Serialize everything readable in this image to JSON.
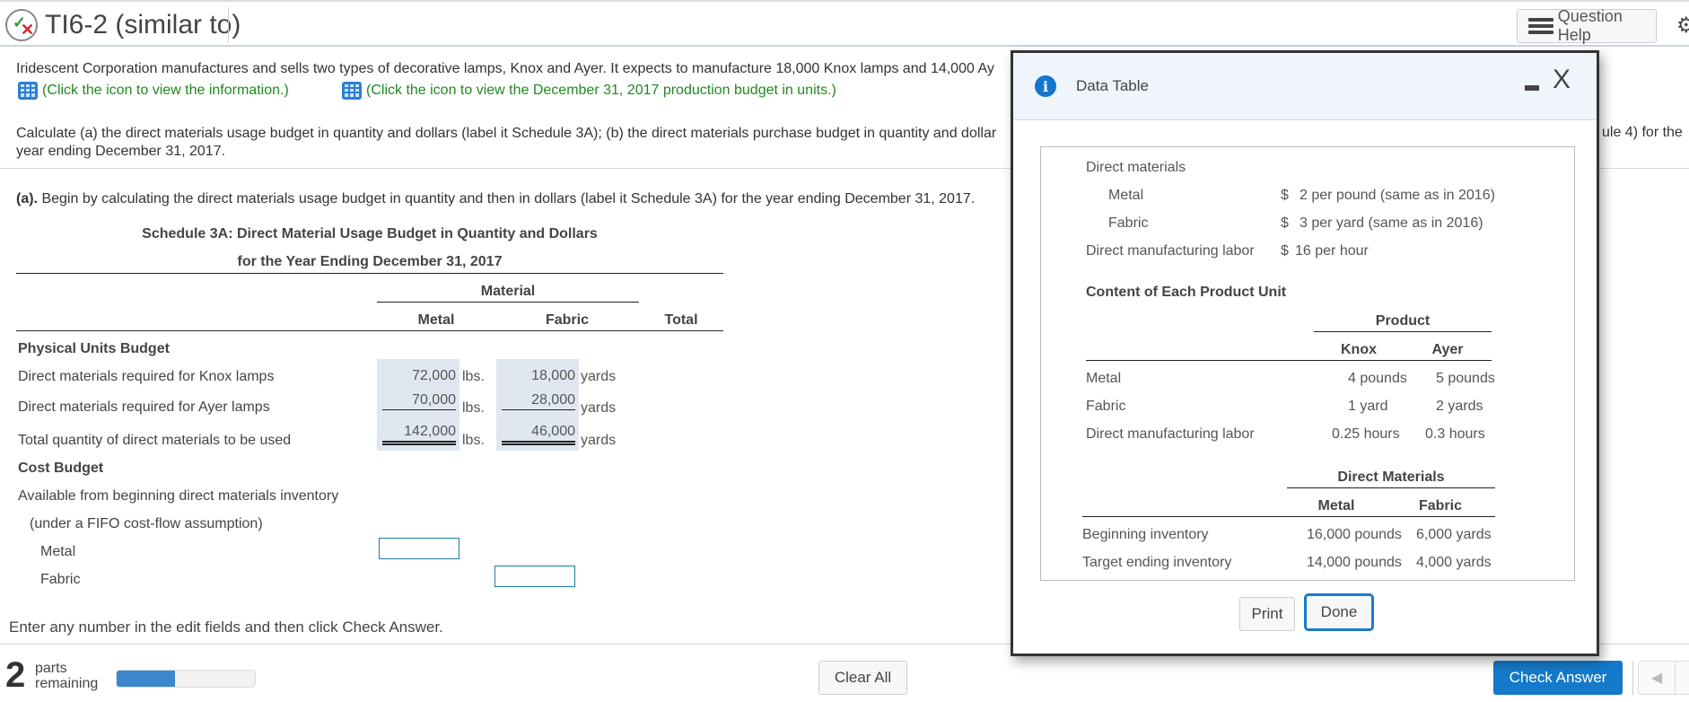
{
  "header": {
    "title": "TI6-2 (similar to)",
    "question_help_label": "Question Help"
  },
  "question": {
    "intro": "Iridescent Corporation manufactures and sells two types of decorative lamps, Knox and Ayer. It expects to manufacture 18,000 Knox lamps and 14,000 Ay",
    "link_info": "(Click the icon to view the information.)",
    "link_production": "(Click the icon to view the December 31, 2017 production budget in units.)",
    "calc_line1_left": "Calculate (a) the direct materials usage budget in quantity and dollars (label it Schedule 3A); (b) the direct materials purchase budget in quantity and dollar",
    "calc_line1_right": "ule 4) for the",
    "calc_line2": "year ending December 31, 2017.",
    "part_a_label": "(a).",
    "part_a_text": " Begin by calculating the direct materials usage budget in quantity and then in dollars (label it Schedule 3A) for the year ending December 31, 2017."
  },
  "schedule": {
    "title1": "Schedule 3A: Direct Material Usage Budget in Quantity and Dollars",
    "title2": "for the Year Ending December 31, 2017",
    "group_header": "Material",
    "columns": [
      "Metal",
      "Fabric",
      "Total"
    ],
    "section_physical": "Physical Units Budget",
    "rows": [
      {
        "label": "Direct materials required for Knox lamps",
        "metal": "72,000",
        "metal_unit": "lbs.",
        "fabric": "18,000",
        "fabric_unit": "yards"
      },
      {
        "label": "Direct materials required for Ayer lamps",
        "metal": "70,000",
        "metal_unit": "lbs.",
        "fabric": "28,000",
        "fabric_unit": "yards"
      },
      {
        "label": "Total quantity of direct materials to be used",
        "metal": "142,000",
        "metal_unit": "lbs.",
        "fabric": "46,000",
        "fabric_unit": "yards"
      }
    ],
    "section_cost": "Cost Budget",
    "cost_line1": "Available from beginning direct materials inventory",
    "cost_line2": "(under a FIFO cost-flow assumption)",
    "cost_metal": "Metal",
    "cost_fabric": "Fabric",
    "metal_input_value": "",
    "fabric_input_value": ""
  },
  "instruction": "Enter any number in the edit fields and then click Check Answer.",
  "footer": {
    "parts_count": "2",
    "parts_line1": "parts",
    "parts_line2": "remaining",
    "progress_fraction": 0.42,
    "clear_all_label": "Clear All",
    "check_answer_label": "Check Answer",
    "prev_icon": "◀"
  },
  "modal": {
    "title": "Data Table",
    "direct_materials_label": "Direct materials",
    "metal_label": "Metal",
    "metal_currency": "$",
    "metal_price": "2 per pound (same as in 2016)",
    "fabric_label": "Fabric",
    "fabric_currency": "$",
    "fabric_price": "3 per yard (same as in 2016)",
    "labor_label": "Direct manufacturing labor",
    "labor_currency": "$",
    "labor_price": "16 per hour",
    "content_heading": "Content of Each Product Unit",
    "product_header": "Product",
    "product_columns": [
      "Knox",
      "Ayer"
    ],
    "product_rows": [
      {
        "label": "Metal",
        "knox": "4 pounds",
        "ayer": "5 pounds"
      },
      {
        "label": "Fabric",
        "knox": "1 yard",
        "ayer": "2 yards"
      },
      {
        "label": "Direct manufacturing labor",
        "knox": "0.25 hours",
        "ayer": "0.3 hours"
      }
    ],
    "dm_header": "Direct Materials",
    "dm_columns": [
      "Metal",
      "Fabric"
    ],
    "dm_rows": [
      {
        "label": "Beginning inventory",
        "metal": "16,000 pounds",
        "fabric": "6,000 yards"
      },
      {
        "label": "Target ending inventory",
        "metal": "14,000 pounds",
        "fabric": "4,000 yards"
      }
    ],
    "print_label": "Print",
    "done_label": "Done"
  }
}
